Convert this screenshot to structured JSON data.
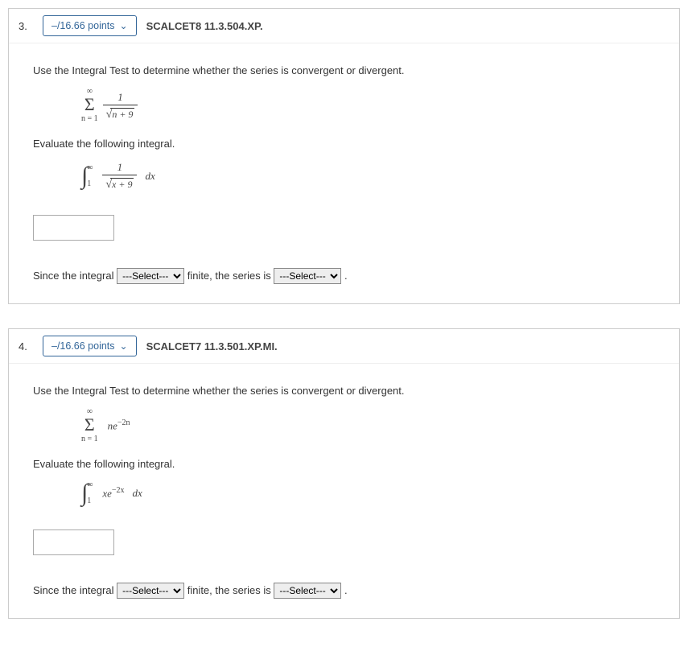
{
  "questions": [
    {
      "number": "3.",
      "points": "–/16.66 points",
      "title": "SCALCET8 11.3.504.XP.",
      "instruction": "Use the Integral Test to determine whether the series is convergent or divergent.",
      "series": {
        "lower": "n = 1",
        "upper": "∞",
        "numerator": "1",
        "under_root": "n + 9"
      },
      "eval_instruction": "Evaluate the following integral.",
      "integral": {
        "lower": "1",
        "upper": "∞",
        "numerator": "1",
        "under_root": "x + 9",
        "diff": "dx"
      },
      "sentence": {
        "p1": "Since the integral",
        "p2": "finite, the series is",
        "select_placeholder": "---Select---",
        "period": "."
      }
    },
    {
      "number": "4.",
      "points": "–/16.66 points",
      "title": "SCALCET7 11.3.501.XP.MI.",
      "instruction": "Use the Integral Test to determine whether the series is convergent or divergent.",
      "series": {
        "lower": "n = 1",
        "upper": "∞",
        "term_base": "ne",
        "term_exp": "−2n"
      },
      "eval_instruction": "Evaluate the following integral.",
      "integral": {
        "lower": "1",
        "upper": "∞",
        "term_base": "xe",
        "term_exp": "−2x",
        "diff": "dx"
      },
      "sentence": {
        "p1": "Since the integral",
        "p2": "finite, the series is",
        "select_placeholder": "---Select---",
        "period": "."
      }
    }
  ]
}
